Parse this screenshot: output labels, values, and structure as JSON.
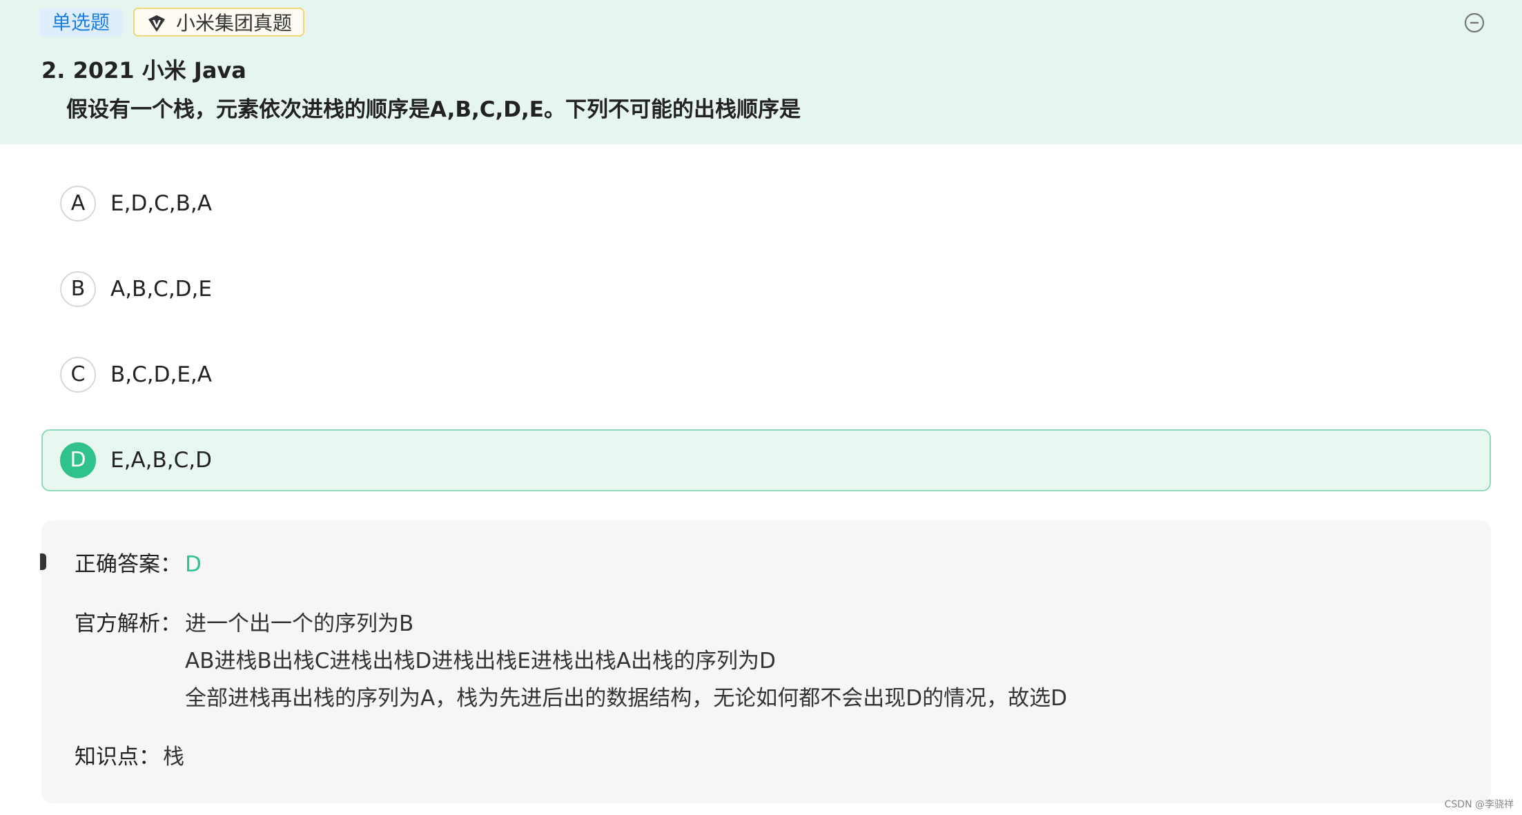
{
  "header": {
    "type_label": "单选题",
    "source_label": "小米集团真题",
    "title": "2. 2021 小米 Java",
    "stem": "假设有一个栈，元素依次进栈的顺序是A,B,C,D,E。下列不可能的出栈顺序是"
  },
  "options": [
    {
      "letter": "A",
      "text": "E,D,C,B,A"
    },
    {
      "letter": "B",
      "text": "A,B,C,D,E"
    },
    {
      "letter": "C",
      "text": "B,C,D,E,A"
    },
    {
      "letter": "D",
      "text": "E,A,B,C,D"
    }
  ],
  "analysis": {
    "answer_label": "正确答案：",
    "answer_value": "D",
    "explain_label": "官方解析：",
    "explain_lines": [
      "进一个出一个的序列为B",
      "AB进栈B出栈C进栈出栈D进栈出栈E进栈出栈A出栈的序列为D",
      "全部进栈再出栈的序列为A，栈为先进后出的数据结构，无论如何都不会出现D的情况，故选D"
    ],
    "knowledge_label": "知识点：",
    "knowledge_value": "栈"
  },
  "watermark": "CSDN @李骁祥",
  "colors": {
    "header_bg": "#e7f5f0",
    "accent_green": "#2fc28c",
    "type_tag_blue": "#1c7fe0"
  },
  "icons": {
    "source_logo": "v-badge-icon",
    "collapse": "minus-circle-icon"
  }
}
